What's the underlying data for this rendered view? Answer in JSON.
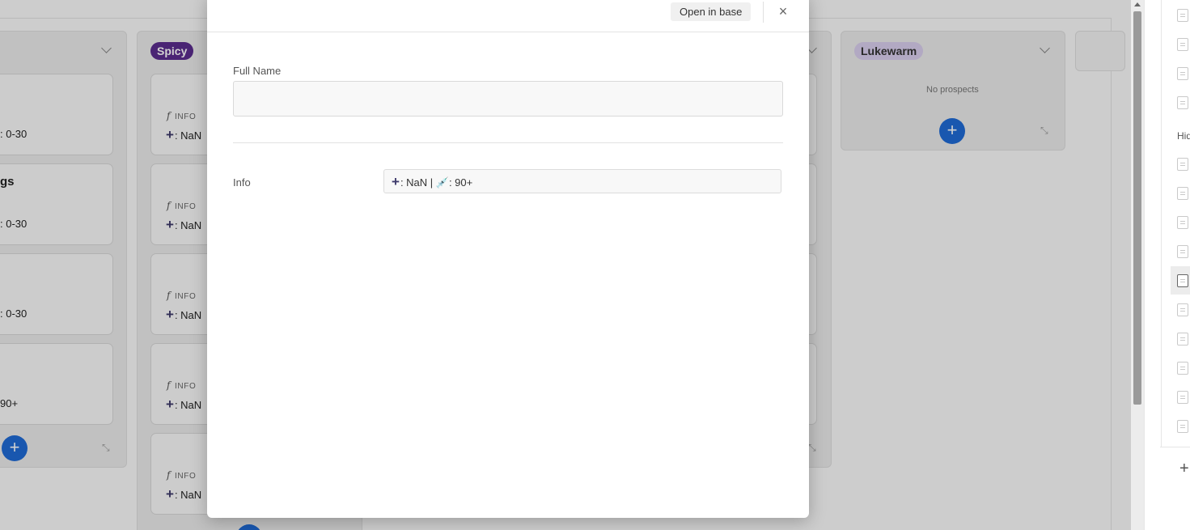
{
  "board": {
    "columns": [
      {
        "name": "",
        "cards": [
          {
            "title": "",
            "info": ": 0-30"
          },
          {
            "title": "gs",
            "info": ": 0-30"
          },
          {
            "title": "",
            "info": ": 0-30"
          },
          {
            "title": "",
            "info": "90+"
          }
        ]
      },
      {
        "name": "Spicy",
        "color": "#5b2d8e",
        "cards": [
          {
            "label": "INFO",
            "info": ": NaN"
          },
          {
            "label": "INFO",
            "info": ": NaN"
          },
          {
            "label": "INFO",
            "info": ": NaN"
          },
          {
            "label": "INFO",
            "info": ": NaN"
          },
          {
            "label": "INFO",
            "info": ": NaN"
          }
        ]
      },
      {
        "name": "Lukewarm",
        "color": "#d9cfee",
        "empty_text": "No prospects"
      }
    ],
    "add_label": "+"
  },
  "sidebar": {
    "hidden_label": "Hid",
    "add_label": "+"
  },
  "modal": {
    "open_in_base_label": "Open in base",
    "close_label": "×",
    "full_name_label": "Full Name",
    "full_name_value": "",
    "info_label": "Info",
    "info_value": ": NaN | 💉: 90+",
    "info_prefix_icon": "+"
  }
}
